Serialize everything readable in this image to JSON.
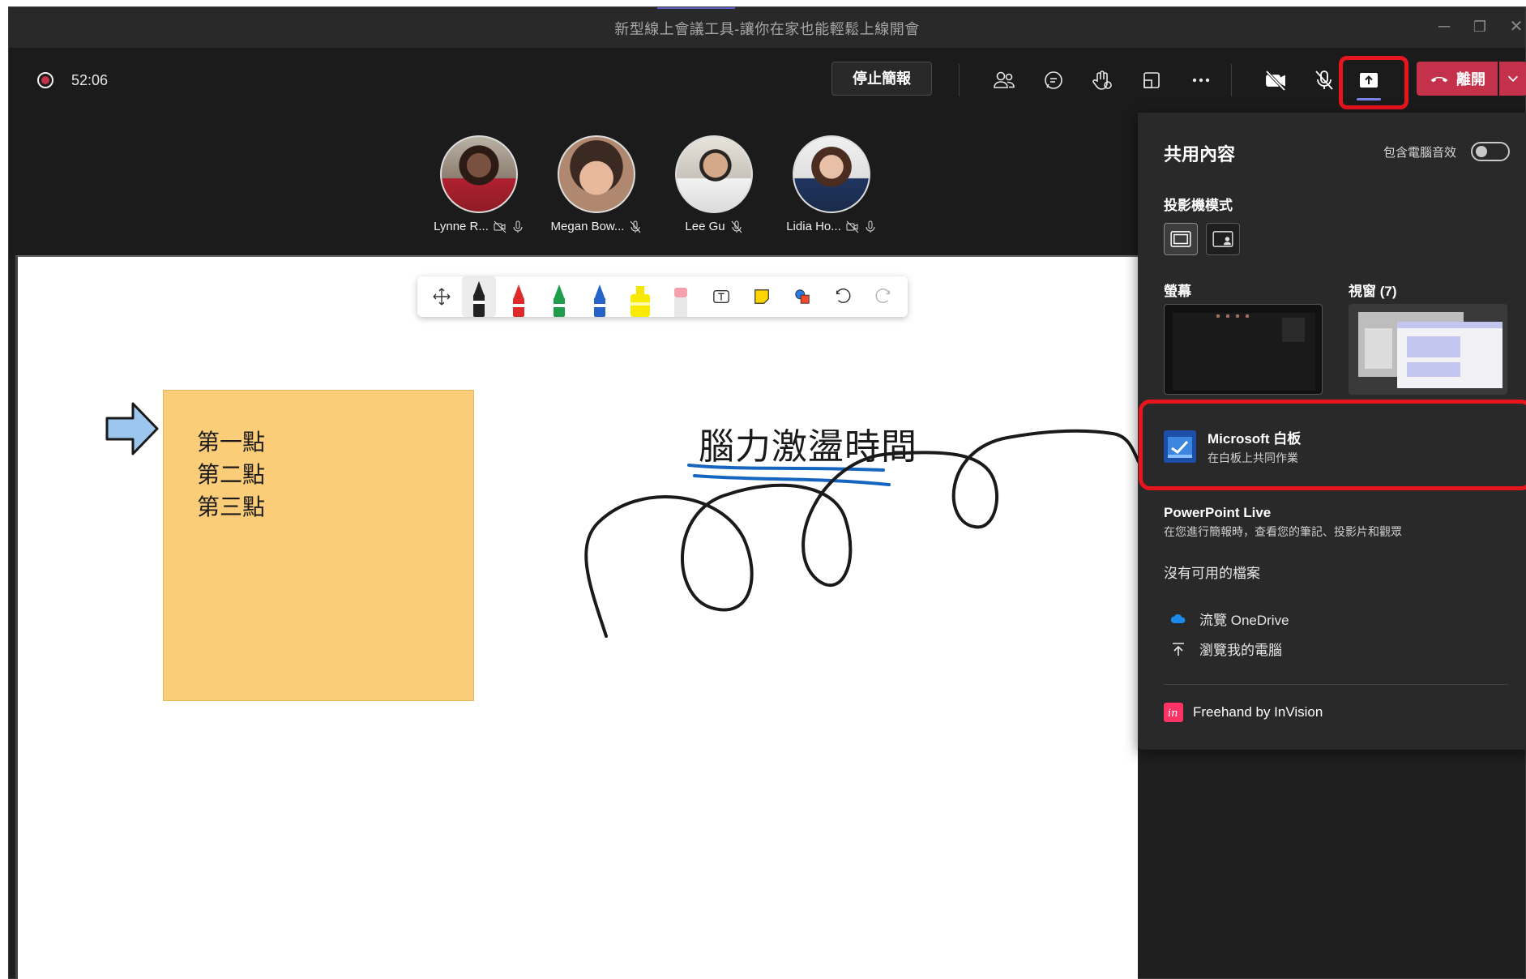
{
  "window": {
    "title": "新型線上會議工具-讓你在家也能輕鬆上線開會",
    "minimize_glyph": "─",
    "restore_glyph": "❐",
    "close_glyph": "✕"
  },
  "toolbar": {
    "timer": "52:06",
    "stop_presenting_label": "停止簡報",
    "leave_label": "離開",
    "icons": [
      "people-icon",
      "chat-icon",
      "raise-hand-icon",
      "room-icon",
      "more-icon",
      "camera-off-icon",
      "mic-off-icon",
      "share-icon"
    ]
  },
  "participants": [
    {
      "name": "Lynne R...",
      "icons": [
        "camera-off-icon",
        "mic-icon"
      ]
    },
    {
      "name": "Megan Bow...",
      "icons": [
        "mic-off-icon"
      ]
    },
    {
      "name": "Lee Gu",
      "icons": [
        "mic-off-icon"
      ]
    },
    {
      "name": "Lidia Ho...",
      "icons": [
        "camera-off-icon",
        "mic-icon"
      ]
    }
  ],
  "whiteboard": {
    "sticky_lines": [
      "第一點",
      "第二點",
      "第三點"
    ],
    "title_text": "腦力激盪時間",
    "tools": [
      "move-icon",
      "pen-black",
      "pen-red",
      "pen-green",
      "pen-blue",
      "highlighter-yellow",
      "eraser",
      "text-icon",
      "sticky-note-icon",
      "shapes-icon",
      "undo-icon",
      "redo-icon"
    ],
    "colors": {
      "sticky": "#fbcd79",
      "underline": "#1565c0",
      "ink": "#1a1a1a"
    }
  },
  "share_panel": {
    "title": "共用內容",
    "audio_label": "包含電腦音效",
    "audio_on": false,
    "presenter_mode_label": "投影機模式",
    "screen_label": "螢幕",
    "window_label": "視窗 (7)",
    "whiteboard_app": {
      "title": "Microsoft 白板",
      "subtitle": "在白板上共同作業"
    },
    "ppt_live": {
      "title": "PowerPoint Live",
      "subtitle": "在您進行簡報時，查看您的筆記、投影片和觀眾"
    },
    "no_files": "沒有可用的檔案",
    "browse_onedrive": "流覽 OneDrive",
    "browse_computer": "瀏覽我的電腦",
    "freehand": "Freehand by InVision"
  },
  "accent_colors": {
    "highlight_box": "#e8141e",
    "leave": "#c4314b",
    "teams_purple": "#7b83eb"
  }
}
